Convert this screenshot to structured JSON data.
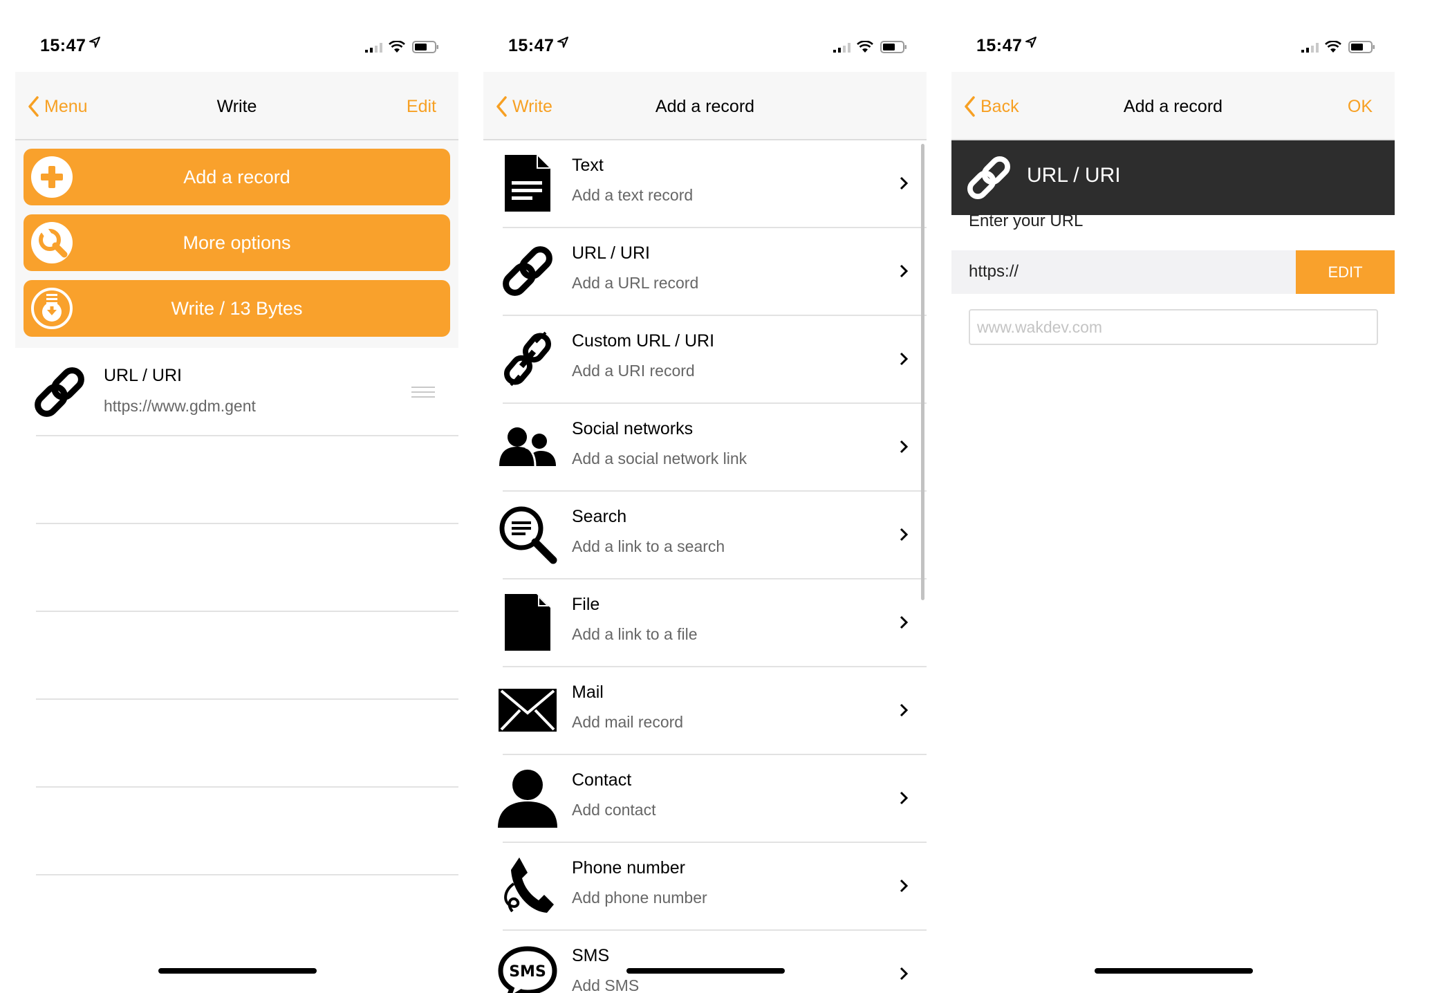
{
  "theme": {
    "accent": "#f9a12c",
    "dark_header": "#2d2d2d"
  },
  "screens": {
    "write": {
      "status": {
        "time": "15:47"
      },
      "nav": {
        "back": "Menu",
        "title": "Write",
        "right": "Edit"
      },
      "buttons": {
        "add": "Add a record",
        "more": "More options",
        "write": "Write / 13 Bytes"
      },
      "records": [
        {
          "title": "URL / URI",
          "value": "https://www.gdm.gent",
          "icon": "link-icon"
        }
      ]
    },
    "add_record": {
      "status": {
        "time": "15:47"
      },
      "nav": {
        "back": "Write",
        "title": "Add a record"
      },
      "items": [
        {
          "title": "Text",
          "subtitle": "Add a text record",
          "icon": "document-text-icon"
        },
        {
          "title": "URL / URI",
          "subtitle": "Add a URL record",
          "icon": "link-icon"
        },
        {
          "title": "Custom URL / URI",
          "subtitle": "Add a URI record",
          "icon": "custom-link-icon"
        },
        {
          "title": "Social networks",
          "subtitle": "Add a social network link",
          "icon": "people-icon"
        },
        {
          "title": "Search",
          "subtitle": "Add a link to a search",
          "icon": "search-icon"
        },
        {
          "title": "File",
          "subtitle": "Add a link to a file",
          "icon": "file-icon"
        },
        {
          "title": "Mail",
          "subtitle": "Add mail record",
          "icon": "mail-icon"
        },
        {
          "title": "Contact",
          "subtitle": "Add contact",
          "icon": "contact-icon"
        },
        {
          "title": "Phone number",
          "subtitle": "Add phone number",
          "icon": "phone-icon"
        },
        {
          "title": "SMS",
          "subtitle": "Add SMS",
          "icon": "sms-icon"
        }
      ]
    },
    "url_record": {
      "status": {
        "time": "15:47"
      },
      "nav": {
        "back": "Back",
        "title": "Add a record",
        "right": "OK"
      },
      "header": {
        "title": "URL / URI",
        "icon": "link-icon"
      },
      "label": "Enter your URL",
      "prefix": "https://",
      "edit": "EDIT",
      "input": {
        "value": "",
        "placeholder": "www.wakdev.com"
      }
    }
  }
}
